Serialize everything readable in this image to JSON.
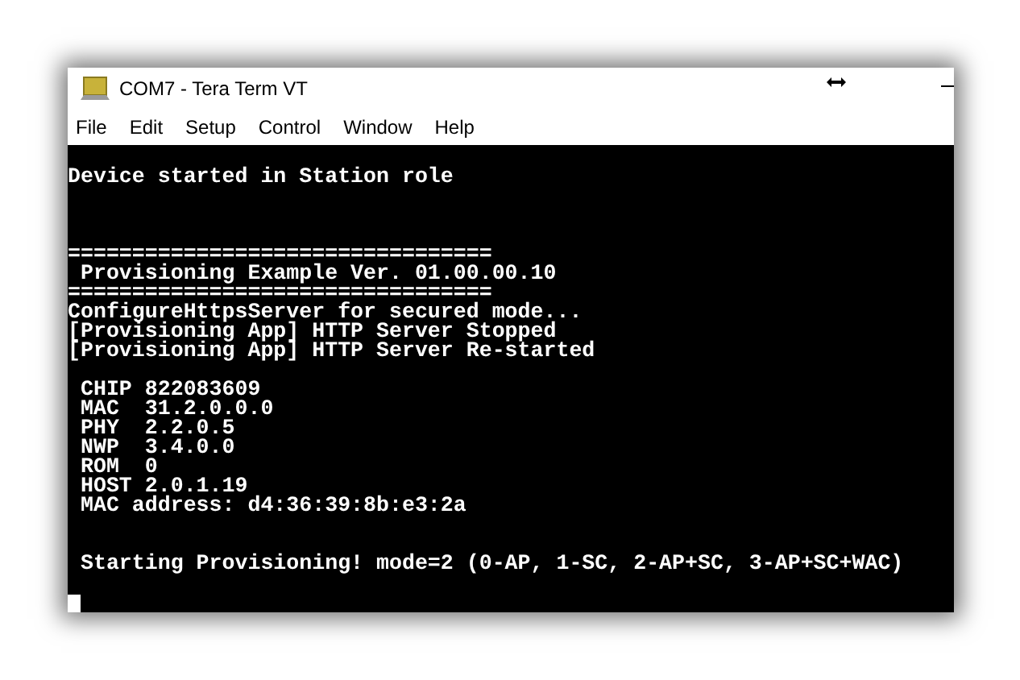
{
  "window": {
    "title": "COM7 - Tera Term VT"
  },
  "menu": [
    "File",
    "Edit",
    "Setup",
    "Control",
    "Window",
    "Help"
  ],
  "terminal": {
    "lines": [
      {
        "kind": "text",
        "text": "Device started in Station role"
      },
      {
        "kind": "blank"
      },
      {
        "kind": "blank"
      },
      {
        "kind": "blank"
      },
      {
        "kind": "text",
        "text": "================================="
      },
      {
        "kind": "text",
        "text": " Provisioning Example Ver. 01.00.00.10"
      },
      {
        "kind": "text",
        "text": "================================="
      },
      {
        "kind": "text",
        "text": "ConfigureHttpsServer for secured mode..."
      },
      {
        "kind": "text",
        "text": "[Provisioning App] HTTP Server Stopped"
      },
      {
        "kind": "text",
        "text": "[Provisioning App] HTTP Server Re-started"
      },
      {
        "kind": "blank"
      },
      {
        "kind": "text",
        "text": " CHIP 822083609"
      },
      {
        "kind": "text",
        "text": " MAC  31.2.0.0.0"
      },
      {
        "kind": "text",
        "text": " PHY  2.2.0.5"
      },
      {
        "kind": "text",
        "text": " NWP  3.4.0.0"
      },
      {
        "kind": "text",
        "text": " ROM  0"
      },
      {
        "kind": "text",
        "text": " HOST 2.0.1.19"
      },
      {
        "kind": "text",
        "text": " MAC address: d4:36:39:8b:e3:2a"
      },
      {
        "kind": "blank"
      },
      {
        "kind": "blank"
      },
      {
        "kind": "text",
        "text": " Starting Provisioning! mode=2 (0-AP, 1-SC, 2-AP+SC, 3-AP+SC+WAC)"
      },
      {
        "kind": "blank"
      },
      {
        "kind": "cursor"
      }
    ]
  }
}
